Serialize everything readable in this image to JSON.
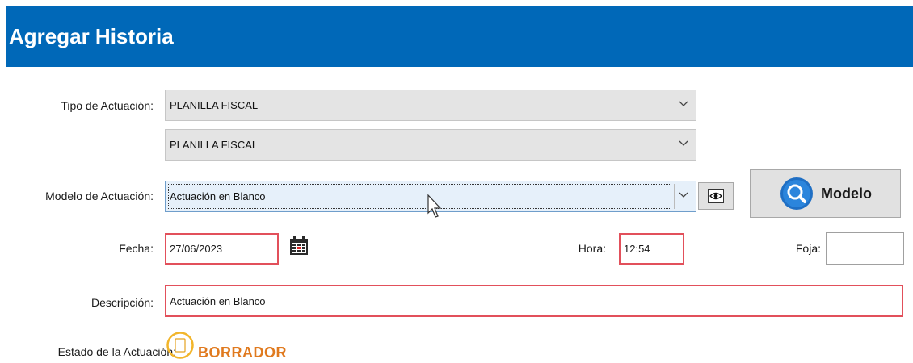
{
  "window": {
    "title": "Agregar Historia",
    "title_bg": "#0068b8"
  },
  "form": {
    "tipo_label": "Tipo de Actuación:",
    "tipo_value_1": "PLANILLA FISCAL",
    "tipo_value_2": "PLANILLA FISCAL",
    "modelo_label": "Modelo de Actuación:",
    "modelo_value": "Actuación en Blanco",
    "preview_icon": "eye-icon",
    "modelo_button_label": "Modelo",
    "modelo_button_icon": "search-icon",
    "fecha_label": "Fecha:",
    "fecha_value": "27/06/2023",
    "calendar_icon": "calendar-icon",
    "hora_label": "Hora:",
    "hora_value": "12:54",
    "foja_label": "Foja:",
    "foja_value": "",
    "descripcion_label": "Descripción:",
    "descripcion_value": "Actuación en Blanco",
    "estado_label": "Estado de la Actuación:",
    "estado_value": "BORRADOR",
    "estado_icon": "document-icon"
  },
  "colors": {
    "required_border": "#e2505b",
    "accent_orange": "#e07a1f",
    "search_blue": "#1f6fc4"
  }
}
